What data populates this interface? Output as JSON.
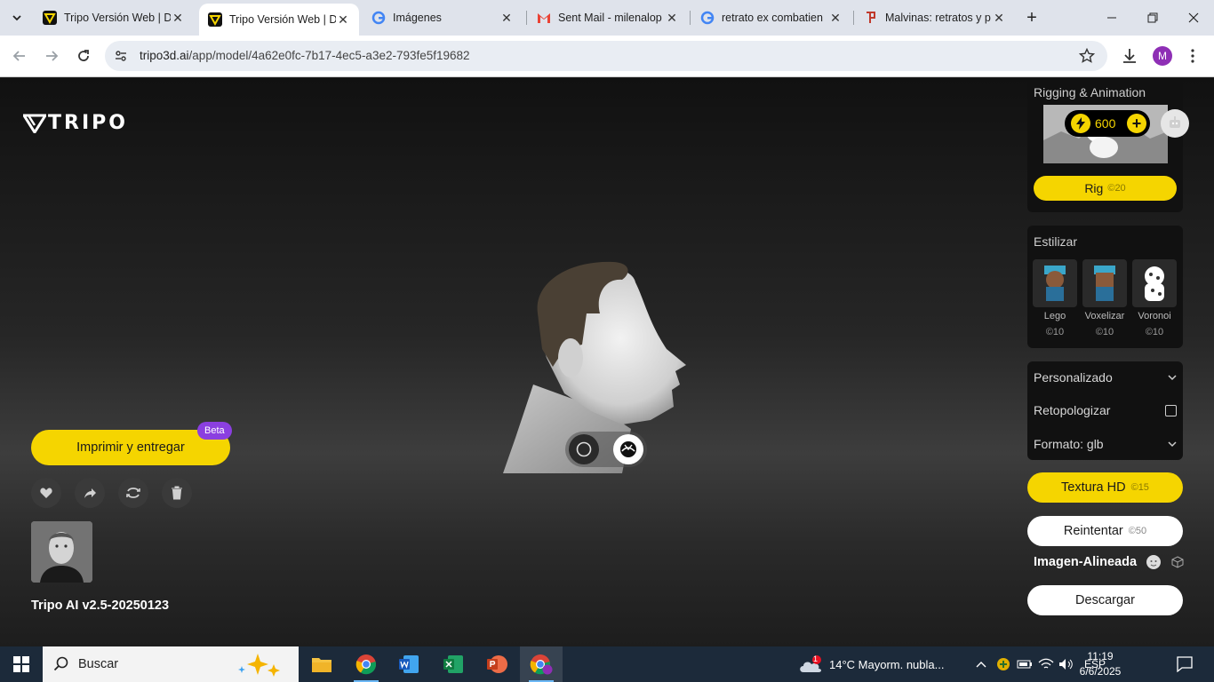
{
  "browser": {
    "tabs": [
      {
        "title": "Tripo Versión Web | D",
        "icon": "tripo-icon",
        "active": false
      },
      {
        "title": "Tripo Versión Web | D",
        "icon": "tripo-icon",
        "active": true
      },
      {
        "title": "Imágenes",
        "icon": "google-icon",
        "active": false
      },
      {
        "title": "Sent Mail - milenalop",
        "icon": "gmail-icon",
        "active": false
      },
      {
        "title": "retrato ex combatien",
        "icon": "google-icon",
        "active": false
      },
      {
        "title": "Malvinas: retratos y p",
        "icon": "site-icon",
        "active": false
      }
    ],
    "url_host": "tripo3d.ai",
    "url_path": "/app/model/4a62e0fc-7b17-4ec5-a3e2-793fe5f19682",
    "profile_initial": "M"
  },
  "app": {
    "logo_text": "TRIPO",
    "credits": "600",
    "print_button": "Imprimir y entregar",
    "beta_badge": "Beta",
    "model_version": "Tripo AI v2.5-20250123",
    "rigging": {
      "title": "Rigging & Animation",
      "button": "Rig",
      "cost": "20"
    },
    "stylize": {
      "title": "Estilizar",
      "items": [
        {
          "name": "Lego",
          "cost": "10"
        },
        {
          "name": "Voxelizar",
          "cost": "10"
        },
        {
          "name": "Voronoi",
          "cost": "10"
        }
      ]
    },
    "options": {
      "custom": "Personalizado",
      "retopologize": "Retopologizar",
      "format": "Formato: glb"
    },
    "texture_hd": {
      "label": "Textura HD",
      "cost": "15"
    },
    "retry": {
      "label": "Reintentar",
      "cost": "50"
    },
    "aligned_image": "Imagen-Alineada",
    "download": "Descargar"
  },
  "taskbar": {
    "search_placeholder": "Buscar",
    "weather": "14°C  Mayorm. nubla...",
    "weather_badge": "1",
    "language": "ESP",
    "time": "11:19",
    "date": "6/6/2025"
  },
  "colors": {
    "accent": "#f5d500",
    "beta": "#8b3fe0",
    "taskbar": "#1c2a3a"
  }
}
